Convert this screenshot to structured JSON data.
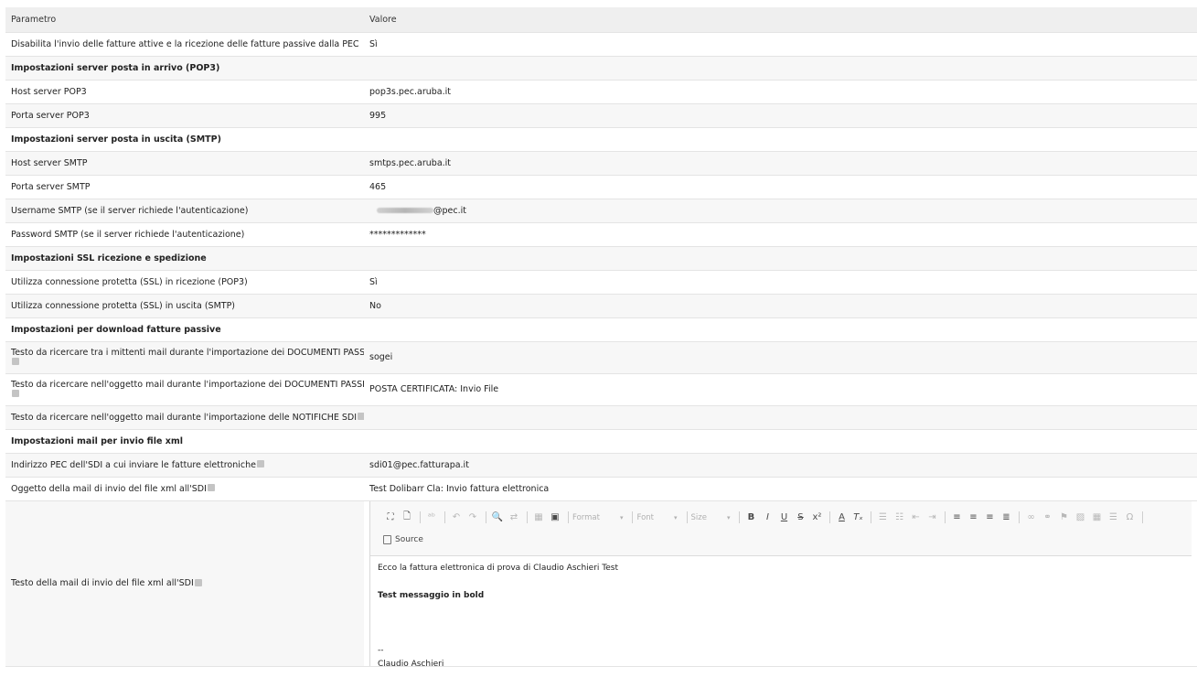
{
  "header": {
    "col_param": "Parametro",
    "col_value": "Valore"
  },
  "rows": [
    {
      "label": "Disabilita l'invio delle fatture attive e la ricezione delle fatture passive dalla PEC",
      "value": "Sì"
    },
    {
      "section": "Impostazioni server posta in arrivo (POP3)"
    },
    {
      "label": "Host server POP3",
      "value": "pop3s.pec.aruba.it"
    },
    {
      "label": "Porta server POP3",
      "value": "995"
    },
    {
      "section": "Impostazioni server posta in uscita (SMTP)"
    },
    {
      "label": "Host server SMTP",
      "value": "smtps.pec.aruba.it"
    },
    {
      "label": "Porta server SMTP",
      "value": "465"
    },
    {
      "label": "Username SMTP (se il server richiede l'autenticazione)",
      "value": "@pec.it"
    },
    {
      "label": "Password SMTP (se il server richiede l'autenticazione)",
      "value": "*************"
    },
    {
      "section": "Impostazioni SSL ricezione e spedizione"
    },
    {
      "label": "Utilizza connessione protetta (SSL) in ricezione (POP3)",
      "value": "Sì"
    },
    {
      "label": "Utilizza connessione protetta (SSL) in uscita (SMTP)",
      "value": "No"
    },
    {
      "section": "Impostazioni per download fatture passive"
    },
    {
      "label": "Testo da ricercare tra i mittenti mail durante l'importazione dei DOCUMENTI PASSIVI",
      "value": "sogei"
    },
    {
      "label": "Testo da ricercare nell'oggetto mail durante l'importazione dei DOCUMENTI PASSIVI",
      "value": "POSTA CERTIFICATA: Invio File"
    },
    {
      "label": "Testo da ricercare nell'oggetto mail durante l'importazione delle NOTIFICHE SDI",
      "value": ""
    },
    {
      "section": "Impostazioni mail per invio file xml"
    },
    {
      "label": "Indirizzo PEC dell'SDI a cui inviare le fatture elettroniche",
      "value": "sdi01@pec.fatturapa.it"
    },
    {
      "label": "Oggetto della mail di invio del file xml all'SDI",
      "value": "Test Dolibarr Cla: Invio fattura elettronica"
    },
    {
      "label": "Testo della mail di invio del file xml all'SDI"
    }
  ],
  "editor": {
    "combo_format": "Format",
    "combo_font": "Font",
    "combo_size": "Size",
    "source_label": "Source",
    "line1": "Ecco la fattura elettronica di prova di Claudio Aschieri Test",
    "line2": "Test messaggio in bold",
    "line3": "--",
    "line4": "Claudio Aschieri"
  },
  "icons": [
    "maximize-icon",
    "preview-icon",
    "spellcheck-icon",
    "undo-icon",
    "redo-icon",
    "find-icon",
    "replace-icon",
    "select-all-icon",
    "templates-icon",
    "bold-icon",
    "italic-icon",
    "underline-icon",
    "strike-icon",
    "superscript-icon",
    "text-color-icon",
    "remove-format-icon",
    "numbered-list-icon",
    "bulleted-list-icon",
    "outdent-icon",
    "indent-icon",
    "align-left-icon",
    "align-center-icon",
    "align-right-icon",
    "justify-icon",
    "link-icon",
    "unlink-icon",
    "anchor-icon",
    "image-icon",
    "table-icon",
    "horizontal-rule-icon",
    "special-char-icon",
    "source-icon",
    "help-icon"
  ],
  "colors": {
    "header_bg": "#efefef",
    "row_alt_bg": "#f7f7f7",
    "border": "#e4e4e4",
    "help_icon": "#c4c4c4"
  }
}
